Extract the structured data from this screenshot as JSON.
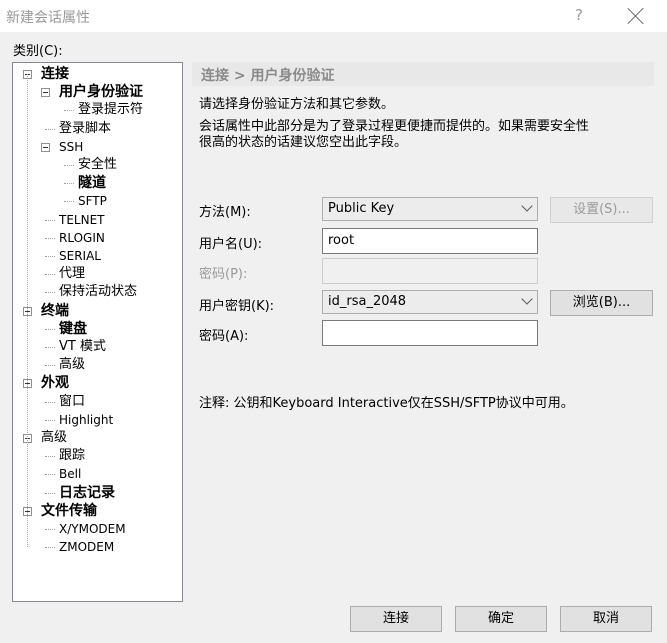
{
  "window": {
    "title": "新建会话属性",
    "help_label": "?"
  },
  "category": {
    "label": "类别(C):"
  },
  "tree": [
    {
      "label": "连接",
      "level": 0,
      "expander": true,
      "bold": true
    },
    {
      "label": "用户身份验证",
      "level": 1,
      "expander": true,
      "bold": true,
      "selected": true
    },
    {
      "label": "登录提示符",
      "level": 2
    },
    {
      "label": "登录脚本",
      "level": 1
    },
    {
      "label": "SSH",
      "level": 1,
      "expander": true,
      "small": true
    },
    {
      "label": "安全性",
      "level": 2
    },
    {
      "label": "隧道",
      "level": 2,
      "bold": true
    },
    {
      "label": "SFTP",
      "level": 2,
      "small": true
    },
    {
      "label": "TELNET",
      "level": 1,
      "small": true
    },
    {
      "label": "RLOGIN",
      "level": 1,
      "small": true
    },
    {
      "label": "SERIAL",
      "level": 1,
      "small": true
    },
    {
      "label": "代理",
      "level": 1
    },
    {
      "label": "保持活动状态",
      "level": 1
    },
    {
      "label": "终端",
      "level": 0,
      "expander": true,
      "bold": true
    },
    {
      "label": "键盘",
      "level": 1,
      "bold": true
    },
    {
      "label": "VT 模式",
      "level": 1
    },
    {
      "label": "高级",
      "level": 1
    },
    {
      "label": "外观",
      "level": 0,
      "expander": true,
      "bold": true
    },
    {
      "label": "窗口",
      "level": 1
    },
    {
      "label": "Highlight",
      "level": 1,
      "small": true
    },
    {
      "label": "高级",
      "level": 0,
      "expander": true
    },
    {
      "label": "跟踪",
      "level": 1
    },
    {
      "label": "Bell",
      "level": 1,
      "small": true
    },
    {
      "label": "日志记录",
      "level": 1,
      "bold": true
    },
    {
      "label": "文件传输",
      "level": 0,
      "expander": true,
      "bold": true
    },
    {
      "label": "X/YMODEM",
      "level": 1,
      "small": true
    },
    {
      "label": "ZMODEM",
      "level": 1,
      "small": true
    }
  ],
  "panel": {
    "header": "连接 > 用户身份验证",
    "desc1": "请选择身份验证方法和其它参数。",
    "desc2": "会话属性中此部分是为了登录过程更便捷而提供的。如果需要安全性",
    "desc3": "很高的状态的话建议您空出此字段。",
    "method_label": "方法(M):",
    "method_value": "Public Key",
    "setup_label": "设置(S)...",
    "username_label": "用户名(U):",
    "username_value": "root",
    "password_label": "密码(P):",
    "userkey_label": "用户密钥(K):",
    "userkey_value": "id_rsa_2048",
    "browse_label": "浏览(B)...",
    "passphrase_label": "密码(A):",
    "passphrase_value": "",
    "note": "注释: 公钥和Keyboard Interactive仅在SSH/SFTP协议中可用。"
  },
  "footer": {
    "connect_label": "连接",
    "ok_label": "确定",
    "cancel_label": "取消"
  }
}
